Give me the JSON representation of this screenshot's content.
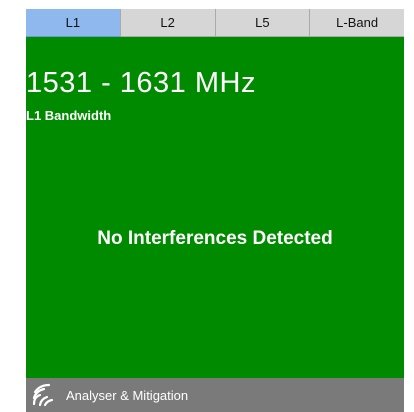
{
  "tabs": [
    {
      "label": "L1",
      "active": true
    },
    {
      "label": "L2",
      "active": false
    },
    {
      "label": "L5",
      "active": false
    },
    {
      "label": "L-Band",
      "active": false
    }
  ],
  "band": {
    "frequency_range": "1531 - 1631 MHz",
    "bandwidth_label": "L1 Bandwidth"
  },
  "status": {
    "message": "No Interferences Detected"
  },
  "footer": {
    "icon": "signal-waves-icon",
    "label": "Analyser & Mitigation"
  },
  "colors": {
    "panel_background": "#008a00",
    "active_tab": "#8fb8ee",
    "inactive_tab": "#d6d6d6",
    "footer_background": "#7a7a7a",
    "text": "#ffffff"
  }
}
